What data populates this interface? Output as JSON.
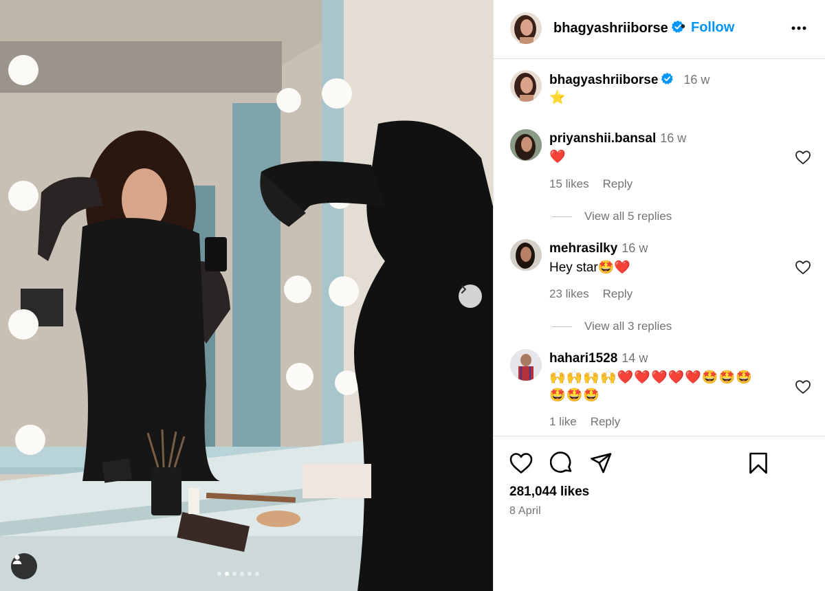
{
  "post": {
    "author": "bhagyashriiborse",
    "follow_label": "Follow",
    "separator": "•",
    "caption": {
      "user": "bhagyashriiborse",
      "time": "16 w",
      "text": "⭐"
    },
    "carousel": {
      "current_index": 1,
      "total": 6
    }
  },
  "comments": [
    {
      "user": "priyanshii.bansal",
      "time": "16 w",
      "text": "❤️",
      "likes_label": "15 likes",
      "reply_label": "Reply",
      "view_replies": "View all 5 replies"
    },
    {
      "user": "mehrasilky",
      "time": "16 w",
      "text": "Hey star🤩❤️",
      "likes_label": "23 likes",
      "reply_label": "Reply",
      "view_replies": "View all 3 replies"
    },
    {
      "user": "hahari1528",
      "time": "14 w",
      "text_line1": "🙌🙌🙌🙌❤️❤️❤️❤️❤️🤩🤩🤩",
      "text_line2": "🤩🤩🤩",
      "likes_label": "1 like",
      "reply_label": "Reply"
    }
  ],
  "footer": {
    "likes": "281,044 likes",
    "date": "8 April"
  },
  "icons": {
    "like": "heart-icon",
    "comment": "comment-icon",
    "share": "send-icon",
    "save": "bookmark-icon",
    "more": "more-options-icon",
    "verified": "verified-badge-icon",
    "next": "chevron-right-icon",
    "tag": "user-tag-icon"
  },
  "colors": {
    "accent": "#0095f6",
    "verified": "#0095f6",
    "heart_red": "#e0245e",
    "muted_text": "#737373"
  }
}
